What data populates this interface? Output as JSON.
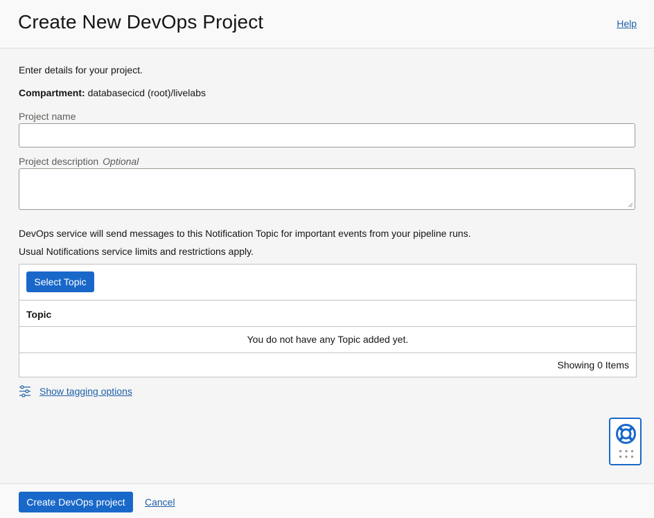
{
  "header": {
    "title": "Create New DevOps Project",
    "help_label": "Help"
  },
  "form": {
    "intro": "Enter details for your project.",
    "compartment_label": "Compartment:",
    "compartment_value": "databasecicd (root)/livelabs",
    "project_name_label": "Project name",
    "project_name_value": "",
    "project_description_label": "Project description",
    "project_description_optional": "Optional",
    "project_description_value": ""
  },
  "notification": {
    "line1": "DevOps service will send messages to this Notification Topic for important events from your pipeline runs.",
    "line2": "Usual Notifications service limits and restrictions apply.",
    "select_topic_label": "Select Topic",
    "column_header": "Topic",
    "empty_message": "You do not have any Topic added yet.",
    "showing_text": "Showing 0 Items"
  },
  "tagging": {
    "link_label": "Show tagging options",
    "icon": "sliders-icon"
  },
  "help_widget": {
    "icon": "lifebuoy-icon",
    "grip_icon": "grip-dots-icon"
  },
  "footer": {
    "create_label": "Create DevOps project",
    "cancel_label": "Cancel"
  },
  "colors": {
    "primary_button": "#1968c9",
    "link": "#1d5fa6",
    "background": "#f5f5f5"
  }
}
